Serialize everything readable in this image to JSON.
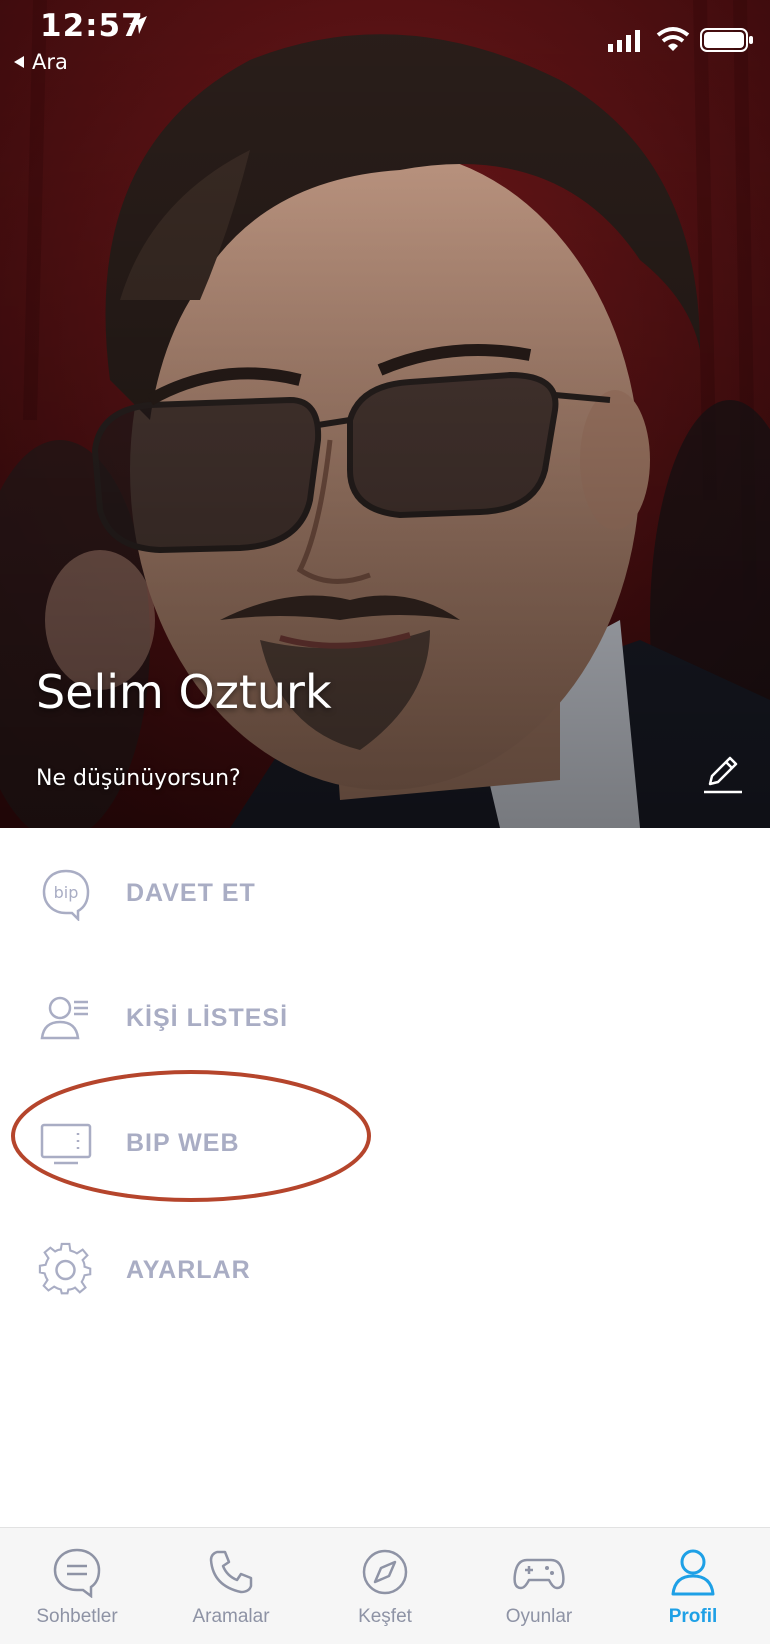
{
  "status_bar": {
    "time": "12:57",
    "back_label": "Ara"
  },
  "profile": {
    "name": "Selim Ozturk",
    "status_message": "Ne düşünüyorsun?"
  },
  "menu": {
    "items": [
      {
        "label": "DAVET ET",
        "icon": "bip-logo-icon"
      },
      {
        "label": "KİŞİ LİSTESİ",
        "icon": "contact-list-icon"
      },
      {
        "label": "BIP WEB",
        "icon": "monitor-icon"
      },
      {
        "label": "AYARLAR",
        "icon": "gear-icon"
      }
    ]
  },
  "tabs": [
    {
      "label": "Sohbetler",
      "icon": "chat-bubble-icon"
    },
    {
      "label": "Aramalar",
      "icon": "phone-icon"
    },
    {
      "label": "Keşfet",
      "icon": "compass-icon"
    },
    {
      "label": "Oyunlar",
      "icon": "gamepad-icon"
    },
    {
      "label": "Profil",
      "icon": "user-icon"
    }
  ],
  "colors": {
    "accent": "#1ea0e6",
    "menu_text": "#a9adc4",
    "highlight_ring": "#b5452c"
  }
}
